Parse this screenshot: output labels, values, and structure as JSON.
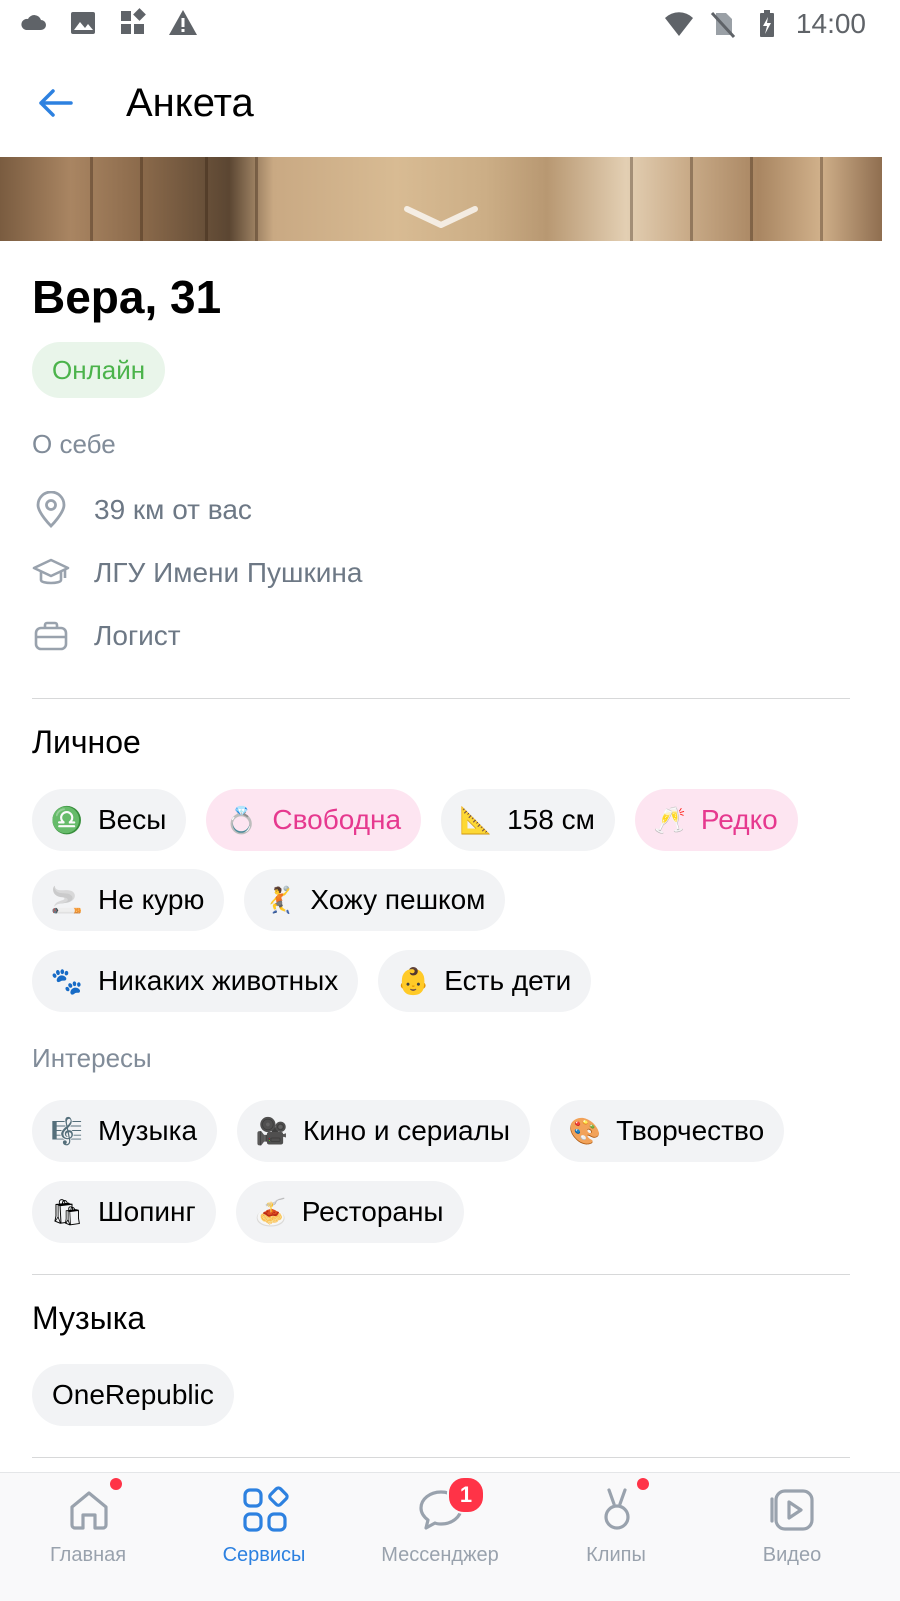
{
  "status_bar": {
    "time": "14:00",
    "left_icons": [
      "cloud-icon",
      "image-icon",
      "widgets-icon",
      "warning-icon"
    ],
    "right_icons": [
      "wifi-icon",
      "no-sim-icon",
      "battery-charging-icon"
    ]
  },
  "header": {
    "title": "Анкета",
    "back_icon": "arrow-left-icon"
  },
  "profile": {
    "name": "Вера, 31",
    "status": "Онлайн",
    "about_label": "О себе",
    "info": [
      {
        "icon": "location-pin-icon",
        "text": "39 км от вас"
      },
      {
        "icon": "graduation-cap-icon",
        "text": "ЛГУ Имени Пушкина"
      },
      {
        "icon": "briefcase-icon",
        "text": "Логист"
      }
    ]
  },
  "personal": {
    "title": "Личное",
    "chips": [
      {
        "emoji": "♎",
        "label": "Весы",
        "highlight": false
      },
      {
        "emoji": "💍",
        "label": "Свободна",
        "highlight": true
      },
      {
        "emoji": "📐",
        "label": "158 см",
        "highlight": false
      },
      {
        "emoji": "🥂",
        "label": "Редко",
        "highlight": true
      },
      {
        "emoji": "🚬",
        "label": "Не курю",
        "highlight": false
      },
      {
        "emoji": "🤾",
        "label": "Хожу пешком",
        "highlight": false
      },
      {
        "emoji": "🐾",
        "label": "Никаких животных",
        "highlight": false
      },
      {
        "emoji": "👶",
        "label": "Есть дети",
        "highlight": false
      }
    ]
  },
  "interests": {
    "label": "Интересы",
    "chips": [
      {
        "emoji": "🎼",
        "label": "Музыка"
      },
      {
        "emoji": "🎥",
        "label": "Кино и сериалы"
      },
      {
        "emoji": "🎨",
        "label": "Творчество"
      },
      {
        "emoji": "🛍",
        "label": "Шопинг"
      },
      {
        "emoji": "🍝",
        "label": "Рестораны"
      }
    ]
  },
  "music": {
    "title": "Музыка",
    "chips": [
      "OneRepublic"
    ]
  },
  "bottom_nav": {
    "items": [
      {
        "label": "Главная",
        "icon": "home-icon",
        "active": false,
        "dot": true
      },
      {
        "label": "Сервисы",
        "icon": "services-icon",
        "active": true,
        "dot": false
      },
      {
        "label": "Мессенджер",
        "icon": "message-icon",
        "active": false,
        "badge": "1"
      },
      {
        "label": "Клипы",
        "icon": "clips-icon",
        "active": false,
        "dot": true
      },
      {
        "label": "Видео",
        "icon": "video-icon",
        "active": false,
        "dot": false
      }
    ]
  },
  "colors": {
    "accent": "#2d81e0",
    "online_text": "#4bb34b",
    "online_bg": "#e9f5ea",
    "pink_text": "#e6398f",
    "pink_bg": "#fde5f1",
    "chip_bg": "#f2f3f5",
    "secondary_text": "#818c99",
    "badge_red": "#ff3347"
  }
}
